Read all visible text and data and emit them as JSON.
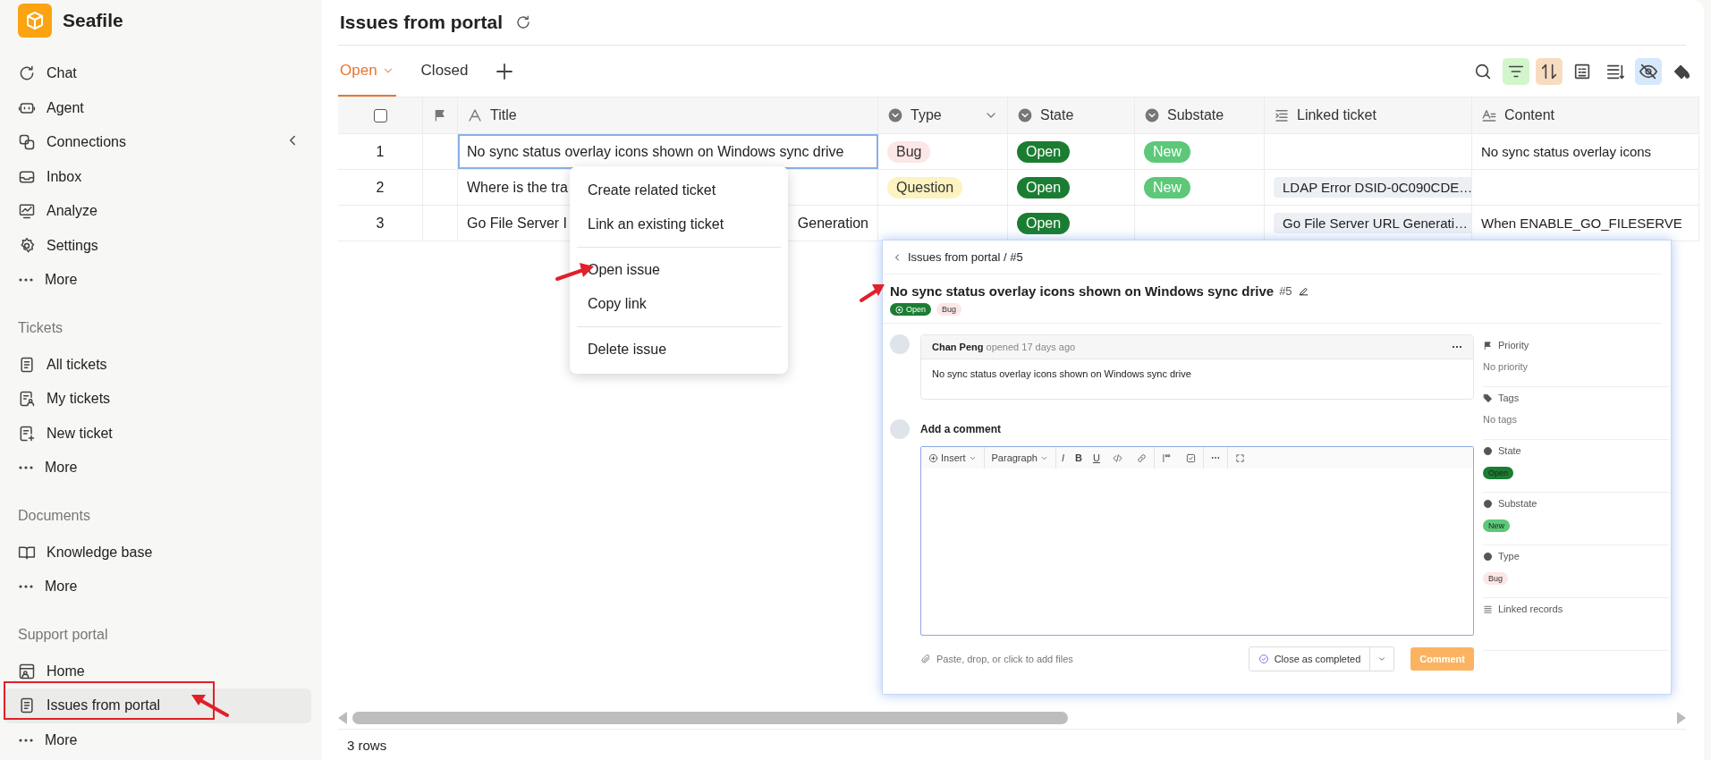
{
  "app": {
    "name": "Seafile"
  },
  "sidebar": {
    "groups": [
      {
        "items": [
          {
            "label": "Chat",
            "selected": false
          },
          {
            "label": "Agent",
            "selected": false
          },
          {
            "label": "Connections",
            "selected": false
          },
          {
            "label": "Inbox",
            "selected": false
          },
          {
            "label": "Analyze",
            "selected": false
          },
          {
            "label": "Settings",
            "selected": false
          },
          {
            "label": "More",
            "selected": false
          }
        ]
      },
      {
        "title": "Tickets",
        "items": [
          {
            "label": "All tickets",
            "selected": false
          },
          {
            "label": "My tickets",
            "selected": false
          },
          {
            "label": "New ticket",
            "selected": false
          },
          {
            "label": "More",
            "selected": false
          }
        ]
      },
      {
        "title": "Documents",
        "items": [
          {
            "label": "Knowledge base",
            "selected": false
          },
          {
            "label": "More",
            "selected": false
          }
        ]
      },
      {
        "title": "Support portal",
        "items": [
          {
            "label": "Home",
            "selected": false
          },
          {
            "label": "Issues from portal",
            "selected": true
          },
          {
            "label": "More",
            "selected": false
          }
        ]
      }
    ]
  },
  "page": {
    "title": "Issues from portal"
  },
  "tabs": [
    {
      "label": "Open",
      "selected": true
    },
    {
      "label": "Closed",
      "selected": false
    }
  ],
  "toolbar": [
    {
      "active": false
    },
    {
      "active": true,
      "color": "#d3f5cc"
    },
    {
      "active": true,
      "color": "#f8dcc0"
    },
    {
      "active": false
    },
    {
      "active": false
    },
    {
      "active": true,
      "color": "#d6e8fc"
    },
    {
      "active": false
    }
  ],
  "table": {
    "select_all": {
      "checked": false
    },
    "columns": [
      {
        "label": "Title"
      },
      {
        "label": "Type"
      },
      {
        "label": "State"
      },
      {
        "label": "Substate"
      },
      {
        "label": "Linked ticket"
      },
      {
        "label": "Content"
      }
    ],
    "rows": [
      {
        "number": "1",
        "selected": true,
        "title": "No sync status overlay icons shown on Windows sync drive",
        "type": {
          "label": "Bug",
          "color": "#fde6e6"
        },
        "state": {
          "label": "Open",
          "color": "#1b7d32"
        },
        "substate": {
          "label": "New",
          "color": "#5cc878"
        },
        "content": "No sync status overlay icons"
      },
      {
        "number": "2",
        "selected": false,
        "title": "Where is the tra",
        "type": {
          "label": "Question",
          "color": "#fdf3c0"
        },
        "state": {
          "label": "Open",
          "color": "#1b7d32"
        },
        "substate": {
          "label": "New",
          "color": "#5cc878"
        },
        "linked_ticket": "LDAP Error DSID-0C090CDE…"
      },
      {
        "number": "3",
        "selected": false,
        "title": "Go File Server I",
        "title_end": "Generation",
        "state": {
          "label": "Open",
          "color": "#1b7d32"
        },
        "linked_ticket": "Go File Server URL Generati…",
        "content": "When ENABLE_GO_FILESERVE"
      }
    ]
  },
  "context_menu": {
    "groups": [
      [
        {
          "label": "Create related ticket"
        },
        {
          "label": "Link an existing ticket"
        }
      ],
      [
        {
          "label": "Open issue"
        },
        {
          "label": "Copy link"
        }
      ],
      [
        {
          "label": "Delete issue"
        }
      ]
    ]
  },
  "issue_preview": {
    "breadcrumb": "Issues from portal / #5",
    "title": "No sync status overlay icons shown on Windows sync drive",
    "number": "#5",
    "state": {
      "label": "Open",
      "color": "#1b7d32"
    },
    "type": {
      "label": "Bug",
      "color": "#fde6e6"
    },
    "comment": {
      "author": "Chan Peng",
      "action": "opened 17 days ago",
      "body": "No sync status overlay icons shown on Windows sync drive"
    },
    "add_comment": "Add a comment",
    "editor": {
      "menus": [
        {
          "label": "Insert"
        },
        {
          "label": "Paragraph"
        }
      ],
      "format_buttons": [
        "I",
        "B",
        "U"
      ]
    },
    "attach_hint": "Paste, drop, or click to add files",
    "close_button": "Close as completed",
    "comment_button": "Comment",
    "details": [
      {
        "kind": "text",
        "label": "Priority",
        "value": "No priority"
      },
      {
        "kind": "text",
        "label": "Tags",
        "value": "No tags"
      },
      {
        "kind": "tag",
        "label": "State",
        "tag": {
          "label": "Open",
          "color": "#1b7d32"
        }
      },
      {
        "kind": "tag",
        "label": "Substate",
        "tag": {
          "label": "New",
          "color": "#5cc878"
        }
      },
      {
        "kind": "tag",
        "label": "Type",
        "tag": {
          "label": "Bug",
          "color": "#fde6e6"
        }
      },
      {
        "kind": "empty",
        "label": "Linked records"
      }
    ]
  },
  "status_bar": {
    "text": "3 rows"
  }
}
